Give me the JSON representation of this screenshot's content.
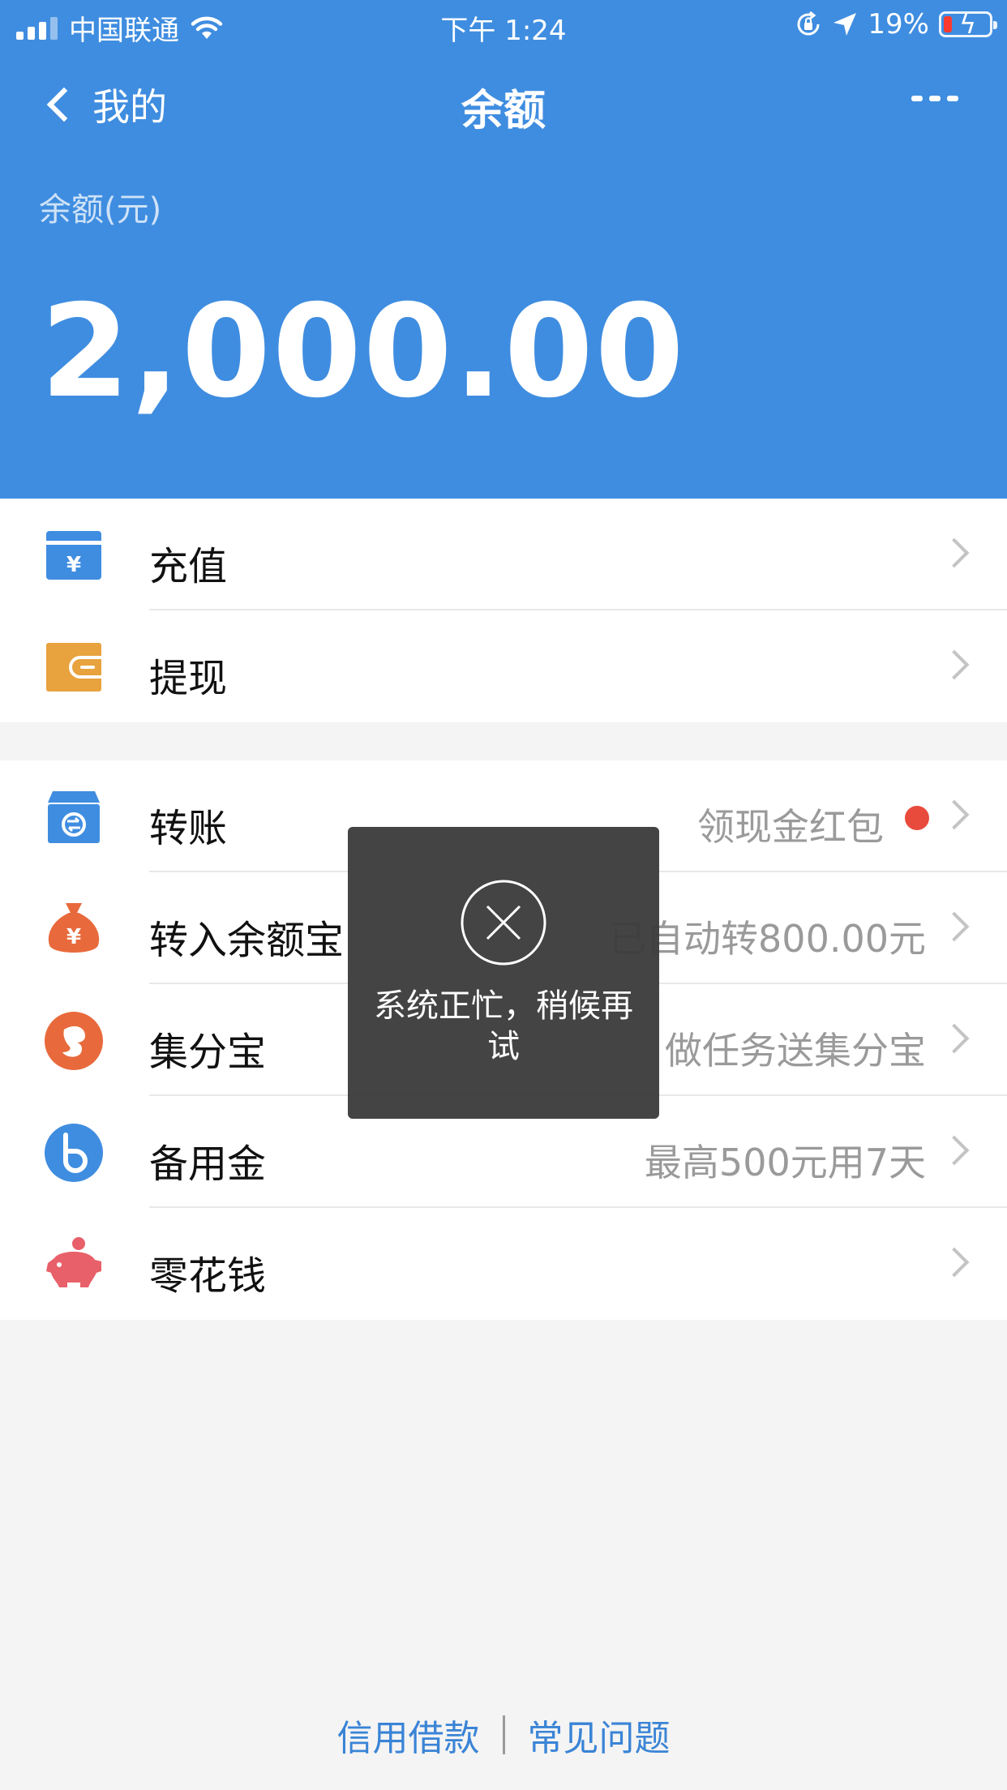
{
  "status_bar": {
    "carrier": "中国联通",
    "time": "下午 1:24",
    "battery": "19%",
    "battery_level": 0.19
  },
  "nav": {
    "back_label": "我的",
    "title": "余额"
  },
  "balance": {
    "label": "余额(元)",
    "amount": "2,000.00"
  },
  "group1": [
    {
      "label": "充值"
    },
    {
      "label": "提现"
    }
  ],
  "group2": [
    {
      "label": "转账",
      "sub": "领现金红包"
    },
    {
      "label": "转入余额宝",
      "sub": "已自动转800.00元"
    },
    {
      "label": "集分宝",
      "sub": "做任务送集分宝"
    },
    {
      "label": "备用金",
      "sub": "最高500元用7天"
    },
    {
      "label": "零花钱",
      "sub": ""
    }
  ],
  "toast": {
    "message": "系统正忙，稍候再试"
  },
  "footer": {
    "link1": "信用借款",
    "link2": "常见问题"
  },
  "colors": {
    "header": "#3f8de0",
    "link": "#3a84d6",
    "badge": "#e84a3c"
  }
}
